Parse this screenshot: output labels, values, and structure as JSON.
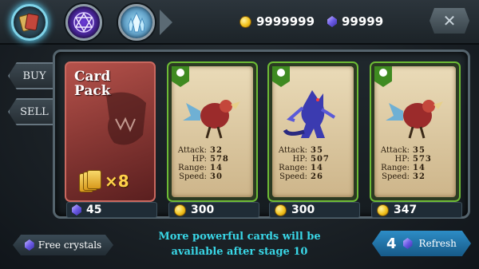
{
  "topbar": {
    "tabs": [
      {
        "name": "cards"
      },
      {
        "name": "magic"
      },
      {
        "name": "towers"
      }
    ],
    "gold": "9999999",
    "crystals": "99999",
    "close_icon": "✕"
  },
  "side_tabs": {
    "buy": "BUY",
    "sell": "SELL"
  },
  "pack": {
    "title_line1": "Card",
    "title_line2": "Pack",
    "quantity": "×8",
    "price": "45",
    "price_currency": "crystal"
  },
  "cards": [
    {
      "creature": "bird",
      "attack": "32",
      "hp": "578",
      "range": "14",
      "speed": "30",
      "price": "300",
      "price_currency": "gold"
    },
    {
      "creature": "wolf",
      "attack": "35",
      "hp": "507",
      "range": "14",
      "speed": "26",
      "price": "300",
      "price_currency": "gold"
    },
    {
      "creature": "bird",
      "attack": "35",
      "hp": "573",
      "range": "14",
      "speed": "32",
      "price": "347",
      "price_currency": "gold"
    }
  ],
  "stat_labels": {
    "attack": "Attack:",
    "hp": "HP:",
    "range": "Range:",
    "speed": "Speed:"
  },
  "footer": {
    "free_crystals": "Free crystals",
    "message_line1": "More powerful cards will be",
    "message_line2": "available after stage 10",
    "refresh_count": "4",
    "refresh_label": "Refresh"
  },
  "colors": {
    "accent_cyan": "#39d6e6",
    "card_border_green": "#6dbb35",
    "pack_red": "#8c3a36",
    "refresh_blue": "#2d8dc6"
  }
}
